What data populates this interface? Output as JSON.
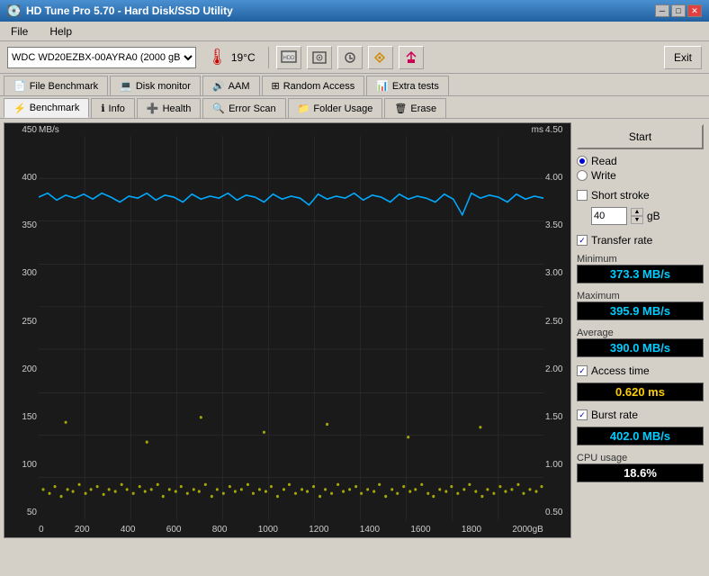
{
  "titleBar": {
    "title": "HD Tune Pro 5.70 - Hard Disk/SSD Utility",
    "icon": "💽",
    "controls": [
      "─",
      "□",
      "✕"
    ]
  },
  "menuBar": {
    "items": [
      "File",
      "Help"
    ]
  },
  "toolbar": {
    "drive": "WDC WD20EZBX-00AYRA0 (2000 gB)",
    "temperature": "19°C",
    "exitLabel": "Exit"
  },
  "tabs1": [
    {
      "label": "File Benchmark",
      "icon": "📄",
      "active": false
    },
    {
      "label": "Disk monitor",
      "icon": "💻",
      "active": false
    },
    {
      "label": "AAM",
      "icon": "🔊",
      "active": false
    },
    {
      "label": "Random Access",
      "icon": "⊞",
      "active": false
    },
    {
      "label": "Extra tests",
      "icon": "📊",
      "active": false
    }
  ],
  "tabs2": [
    {
      "label": "Benchmark",
      "icon": "📊",
      "active": true
    },
    {
      "label": "Info",
      "icon": "ℹ",
      "active": false
    },
    {
      "label": "Health",
      "icon": "➕",
      "active": false
    },
    {
      "label": "Error Scan",
      "icon": "🔍",
      "active": false
    },
    {
      "label": "Folder Usage",
      "icon": "📁",
      "active": false
    },
    {
      "label": "Erase",
      "icon": "🗑",
      "active": false
    }
  ],
  "chart": {
    "yLeftLabel": "MB/s",
    "yRightLabel": "ms",
    "yLeftValues": [
      "450",
      "400",
      "350",
      "300",
      "250",
      "200",
      "150",
      "100",
      "50"
    ],
    "yRightValues": [
      "4.50",
      "4.00",
      "3.50",
      "3.00",
      "2.50",
      "2.00",
      "1.50",
      "1.00",
      "0.50"
    ],
    "xValues": [
      "0",
      "200",
      "400",
      "600",
      "800",
      "1000",
      "1200",
      "1400",
      "1600",
      "1800",
      "2000gB"
    ]
  },
  "rightPanel": {
    "startLabel": "Start",
    "readLabel": "Read",
    "writeLabel": "Write",
    "shortStrokeLabel": "Short stroke",
    "shortStrokeValue": "40",
    "shortStrokeUnit": "gB",
    "transferRateLabel": "Transfer rate",
    "minimumLabel": "Minimum",
    "minimumValue": "373.3 MB/s",
    "maximumLabel": "Maximum",
    "maximumValue": "395.9 MB/s",
    "averageLabel": "Average",
    "averageValue": "390.0 MB/s",
    "accessTimeLabel": "Access time",
    "accessTimeValue": "0.620 ms",
    "burstRateLabel": "Burst rate",
    "burstRateValue": "402.0 MB/s",
    "cpuUsageLabel": "CPU usage",
    "cpuUsageValue": "18.6%"
  }
}
